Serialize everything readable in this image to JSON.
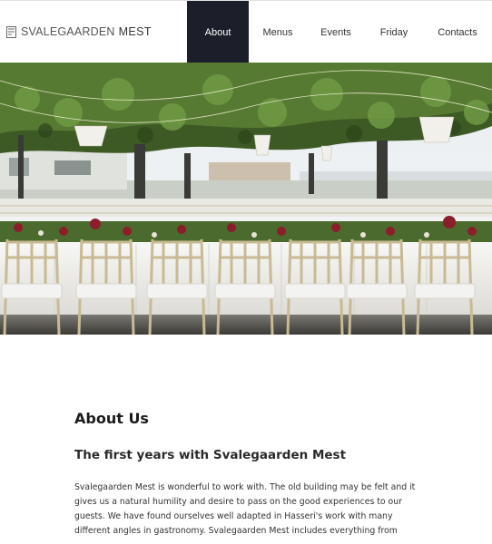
{
  "header": {
    "logo": {
      "light": "SVALEGAARDEN",
      "bold": "MEST",
      "icon": "logo-mark-icon"
    },
    "nav": [
      {
        "label": "About",
        "active": true
      },
      {
        "label": "Menus",
        "active": false
      },
      {
        "label": "Events",
        "active": false
      },
      {
        "label": "Friday",
        "active": false
      },
      {
        "label": "Contacts",
        "active": false
      }
    ],
    "active_color": "#1c1e2a"
  },
  "about": {
    "title": "About Us",
    "subtitle": "The first years with Svalegaarden Mest",
    "body": "Svalegaarden Mest is wonderful to work with. The old building may be felt and it gives us a natural humility and desire to pass on the good experiences to our guests. We have found ourselves well adapted in Hasseri's work with many different angles in gastronomy. Svalegaarden Mest includes everything from"
  }
}
